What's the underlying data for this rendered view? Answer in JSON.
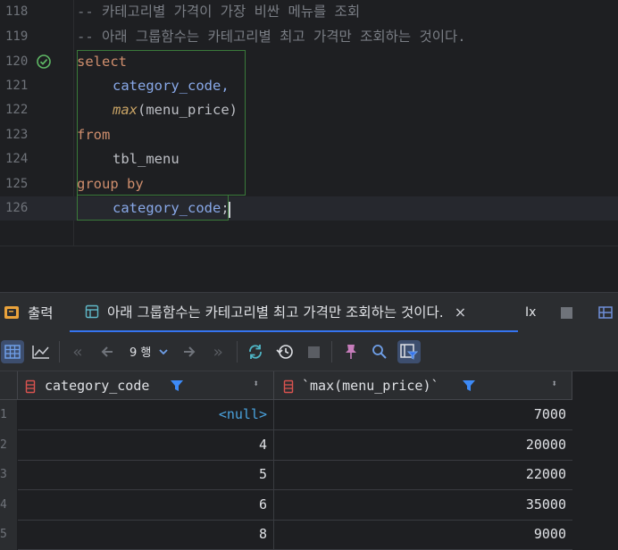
{
  "editor": {
    "lines": [
      {
        "num": "118",
        "text": "-- 카테고리별 가격이 가장 비싼 메뉴를 조회"
      },
      {
        "num": "119",
        "text": "-- 아래 그룹함수는 카테고리별 최고 가격만 조회하는 것이다."
      },
      {
        "num": "120",
        "text": "select"
      },
      {
        "num": "121",
        "text": "category_code,"
      },
      {
        "num": "122",
        "fn": "max",
        "text": "(menu_price)"
      },
      {
        "num": "123",
        "text": "from"
      },
      {
        "num": "124",
        "text": "tbl_menu"
      },
      {
        "num": "125",
        "text": "group by"
      },
      {
        "num": "126",
        "text": "category_code",
        "suffix": ";"
      }
    ]
  },
  "tabs": {
    "output_label": "출력",
    "result_label": "아래 그룹함수는 카테고리별 최고 가격만 조회하는 것이다.",
    "close": "×",
    "extra": "Ix"
  },
  "toolbar": {
    "row_count": "9 행"
  },
  "grid": {
    "columns": [
      "category_code",
      "`max(menu_price)`"
    ],
    "rows": [
      {
        "n": "1",
        "cat": "<null>",
        "max": "7000"
      },
      {
        "n": "2",
        "cat": "4",
        "max": "20000"
      },
      {
        "n": "3",
        "cat": "5",
        "max": "22000"
      },
      {
        "n": "4",
        "cat": "6",
        "max": "35000"
      },
      {
        "n": "5",
        "cat": "8",
        "max": "9000"
      }
    ]
  },
  "colors": {
    "keyword": "#cf8e6d",
    "comment": "#7a7e85",
    "null": "#4aa3df",
    "accent": "#3574f0"
  }
}
